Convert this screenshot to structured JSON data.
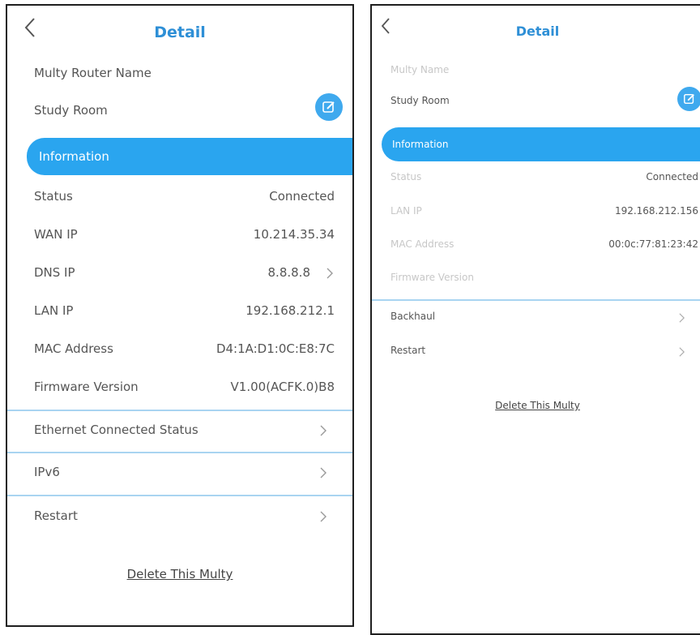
{
  "left_screen": {
    "title": "Detail",
    "name_label": "Multy Router Name",
    "name_value": "Study Room",
    "section_header": "Information",
    "rows": [
      {
        "label": "Status",
        "value": "Connected"
      },
      {
        "label": "WAN IP",
        "value": "10.214.35.34"
      },
      {
        "label": "DNS IP",
        "value": "8.8.8.8"
      },
      {
        "label": "LAN IP",
        "value": "192.168.212.1"
      },
      {
        "label": "MAC Address",
        "value": "D4:1A:D1:0C:E8:7C"
      },
      {
        "label": "Firmware Version",
        "value": "V1.00(ACFK.0)B8"
      }
    ],
    "nav_items": [
      "Ethernet Connected Status",
      "IPv6",
      "Restart"
    ],
    "delete_link": "Delete This Multy"
  },
  "right_screen": {
    "title": "Detail",
    "name_label": "Multy Name",
    "name_value": "Study Room",
    "section_header": "Information",
    "rows": [
      {
        "label": "Status",
        "value": "Connected"
      },
      {
        "label": "LAN IP",
        "value": "192.168.212.156"
      },
      {
        "label": "MAC Address",
        "value": "00:0c:77:81:23:42"
      },
      {
        "label": "Firmware Version",
        "value": ""
      }
    ],
    "nav_items": [
      "Backhaul",
      "Restart"
    ],
    "delete_link": "Delete This Multy"
  },
  "colors": {
    "accent": "#2aa5ef",
    "title": "#2e8fd6",
    "divider": "#a9d4f1"
  },
  "icons": [
    "back-chevron-icon",
    "edit-pencil-icon",
    "chevron-right-icon"
  ]
}
